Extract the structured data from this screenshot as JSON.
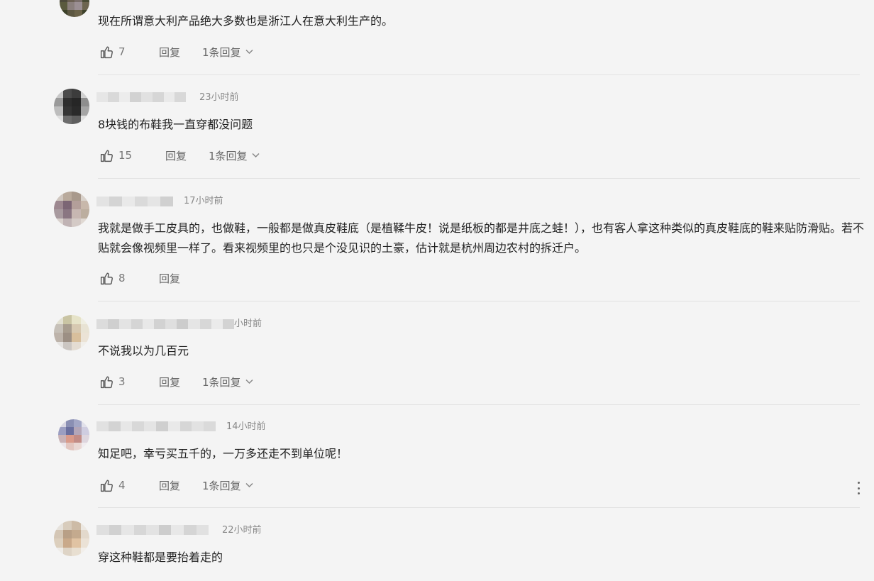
{
  "comments": [
    {
      "time": "",
      "text": "现在所谓意大利产品绝大多数也是浙江人在意大利生产的。",
      "likes": "7",
      "reply_label": "回复",
      "replies_label": "1条回复"
    },
    {
      "time": "23小时前",
      "text": "8块钱的布鞋我一直穿都没问题",
      "likes": "15",
      "reply_label": "回复",
      "replies_label": "1条回复"
    },
    {
      "time": "17小时前",
      "text": "我就是做手工皮具的，也做鞋，一般都是做真皮鞋底（是植鞣牛皮！说是纸板的都是井底之蛙！），也有客人拿这种类似的真皮鞋底的鞋来贴防滑贴。若不贴就会像视频里一样了。看来视频里的也只是个没见识的土豪，估计就是杭州周边农村的拆迁户。",
      "likes": "8",
      "reply_label": "回复",
      "replies_label": ""
    },
    {
      "time": "小时前",
      "text": "不说我以为几百元",
      "likes": "3",
      "reply_label": "回复",
      "replies_label": "1条回复"
    },
    {
      "time": "14小时前",
      "text": "知足吧，幸亏买五千的，一万多还走不到单位呢！",
      "likes": "4",
      "reply_label": "回复",
      "replies_label": "1条回复"
    },
    {
      "time": "22小时前",
      "text": "穿这种鞋都是要抬着走的",
      "likes": "",
      "reply_label": "",
      "replies_label": ""
    }
  ],
  "icons": {
    "like": "thumbs-up-icon",
    "expand": "chevron-down-icon",
    "more": "more-vertical-icon"
  },
  "colors": {
    "background": "#f4f4f4",
    "text": "#222222",
    "meta": "#888888",
    "divider": "#e2e2e2"
  }
}
